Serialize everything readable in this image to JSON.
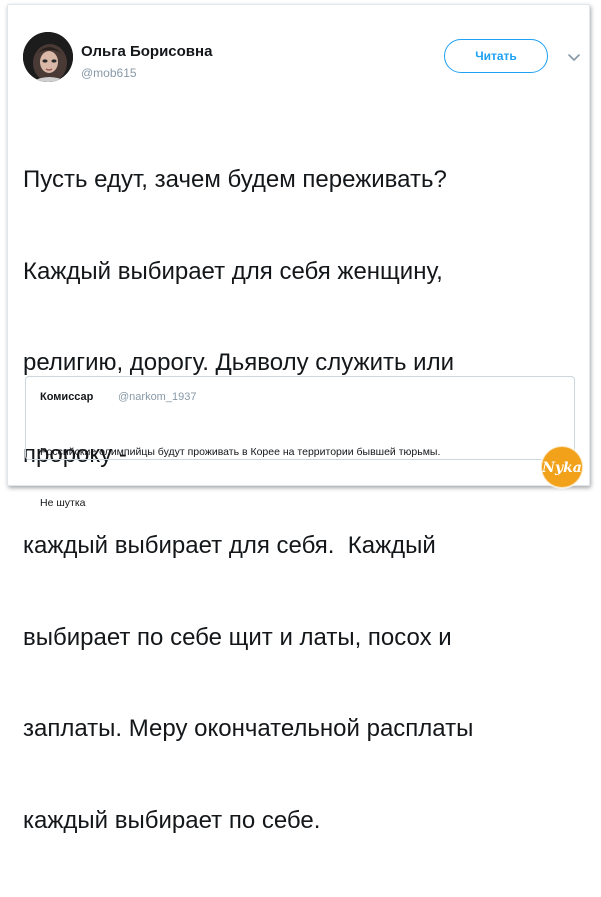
{
  "tweet": {
    "author_name": "Ольга Борисовна",
    "author_handle": "@mob615",
    "follow_label": "Читать",
    "text_lines": [
      "Пусть едут, зачем будем переживать?",
      "Каждый выбирает для себя женщину,",
      "религию, дорогу. Дьяволу служить или",
      "пророку -",
      "каждый выбирает для себя.  Каждый",
      "выбирает по себе щит и латы, посох и",
      "заплаты. Меру окончательной расплаты",
      "каждый выбирает по себе."
    ]
  },
  "quoted_tweet": {
    "author_name": "Комиссар",
    "author_handle": "@narkom_1937",
    "text_lines": [
      "Российские олимпийцы будут проживать в Корее на территории бывшей тюрьмы.",
      "Не шутка"
    ]
  },
  "icons": {
    "avatar": "user-avatar",
    "menu": "chevron-down-icon",
    "watermark": "site-logo-watermark"
  },
  "watermark": {
    "text": "Nyka"
  },
  "colors": {
    "accent": "#1da1f2",
    "text": "#14171a",
    "muted": "#8899a6",
    "border": "#e1e8ed",
    "watermark": "#f2a21a"
  }
}
